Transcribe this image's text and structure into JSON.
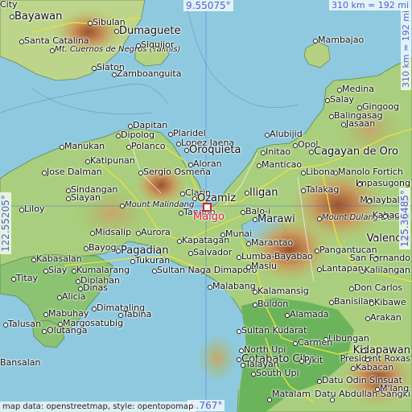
{
  "map": {
    "main_place": "Maigo",
    "coords": {
      "top": "9.55075°",
      "bottom": "6.767°",
      "left": "122.55205°",
      "right": "125.36485°"
    },
    "scales": {
      "horizontal": "310 km = 192 mi",
      "vertical": "310 km = 192 mi"
    },
    "attribution": "map data: openstreetmap, style: opentopomap",
    "labels": [
      {
        "text": "Bayawan",
        "big": true
      },
      {
        "text": "Sibulan"
      },
      {
        "text": "Dumaguete",
        "big": true
      },
      {
        "text": "Santa Catalina"
      },
      {
        "text": "Mt. Cuernos de Negros (Talinis)",
        "italic": true
      },
      {
        "text": "Siquijor"
      },
      {
        "text": "Siaton"
      },
      {
        "text": "Zamboanguita"
      },
      {
        "text": "Mambajao"
      },
      {
        "text": "Medina"
      },
      {
        "text": "Balingasag"
      },
      {
        "text": "Gingoog"
      },
      {
        "text": "Salay"
      },
      {
        "text": "Jasaan"
      },
      {
        "text": "Dapitan"
      },
      {
        "text": "Plaridel"
      },
      {
        "text": "Dipolog"
      },
      {
        "text": "Lopez Jaena"
      },
      {
        "text": "Polanco"
      },
      {
        "text": "Oroquieta",
        "big": true
      },
      {
        "text": "Manukan"
      },
      {
        "text": "Katipunan"
      },
      {
        "text": "Alubijid"
      },
      {
        "text": "Opol"
      },
      {
        "text": "Initao"
      },
      {
        "text": "Cagayan de Oro",
        "big": true
      },
      {
        "text": "Aloran"
      },
      {
        "text": "Manticao"
      },
      {
        "text": "Manolo Fortich"
      },
      {
        "text": "Jose Dalman"
      },
      {
        "text": "Sergio Osmeña"
      },
      {
        "text": "Libona"
      },
      {
        "text": "Impasugong"
      },
      {
        "text": "Sindangan"
      },
      {
        "text": "Siayan"
      },
      {
        "text": "Clarin"
      },
      {
        "text": "Ozamiz",
        "big": true
      },
      {
        "text": "Iligan",
        "big": true
      },
      {
        "text": "Talakag"
      },
      {
        "text": "Malaybalay"
      },
      {
        "text": "Liloy"
      },
      {
        "text": "Mount Malindang",
        "italic": true
      },
      {
        "text": "Tangub"
      },
      {
        "text": "Balo-i"
      },
      {
        "text": "Marawi",
        "big": true
      },
      {
        "text": "Mount Dulang-Dulang",
        "italic": true
      },
      {
        "text": "Kabacan"
      },
      {
        "text": "Midsalip"
      },
      {
        "text": "Aurora"
      },
      {
        "text": "Kapatagan"
      },
      {
        "text": "Munai"
      },
      {
        "text": "Marantao"
      },
      {
        "text": "Valencia",
        "big": true
      },
      {
        "text": "Bayog"
      },
      {
        "text": "Pagadian",
        "big": true
      },
      {
        "text": "Salvador"
      },
      {
        "text": "Lumba-Bayabao"
      },
      {
        "text": "Pangantucan"
      },
      {
        "text": "San Fernando"
      },
      {
        "text": "Kabasalan"
      },
      {
        "text": "Tukuran"
      },
      {
        "text": "Sultan Naga Dimaporo"
      },
      {
        "text": "Masiu"
      },
      {
        "text": "Kalilangan"
      },
      {
        "text": "Lantapan"
      },
      {
        "text": "Siay"
      },
      {
        "text": "Kumalarang"
      },
      {
        "text": "Don Carlos"
      },
      {
        "text": "Diplahan"
      },
      {
        "text": "Titay"
      },
      {
        "text": "Dinas"
      },
      {
        "text": "Malabang"
      },
      {
        "text": "Kalamansig"
      },
      {
        "text": "Banisilan"
      },
      {
        "text": "Kibawe"
      },
      {
        "text": "Alicia"
      },
      {
        "text": "Dimataling"
      },
      {
        "text": "Buldon"
      },
      {
        "text": "Mabuhay"
      },
      {
        "text": "Margosatubig"
      },
      {
        "text": "Tabina"
      },
      {
        "text": "Alamada"
      },
      {
        "text": "Arakan"
      },
      {
        "text": "Talusan"
      },
      {
        "text": "Olutanga"
      },
      {
        "text": "Sultan Kudarat"
      },
      {
        "text": "Libungan"
      },
      {
        "text": "Carmen"
      },
      {
        "text": "Cotabato City",
        "big": true
      },
      {
        "text": "Kidapawan",
        "big": true
      },
      {
        "text": "President Roxas"
      },
      {
        "text": "Kabacan"
      },
      {
        "text": "North Upi"
      },
      {
        "text": "Talayan"
      },
      {
        "text": "Pikit"
      },
      {
        "text": "South Upi"
      },
      {
        "text": "Datu Odin Sinsuat"
      },
      {
        "text": "Matalam"
      },
      {
        "text": "Datu Abdullah Sangki"
      },
      {
        "text": "M'lang"
      },
      {
        "text": "Bansalan"
      },
      {
        "text": "City"
      }
    ]
  }
}
